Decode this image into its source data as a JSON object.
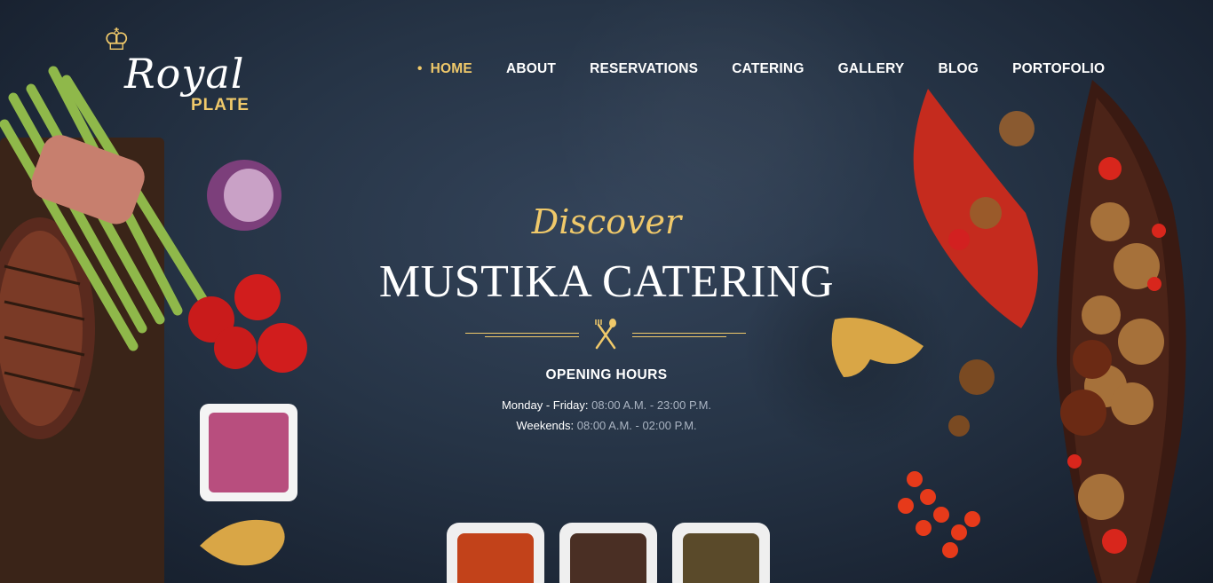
{
  "brand": {
    "logo_word": "Royal",
    "logo_sub": "PLATE"
  },
  "nav": {
    "items": [
      {
        "label": "HOME",
        "active": true
      },
      {
        "label": "ABOUT"
      },
      {
        "label": "RESERVATIONS"
      },
      {
        "label": "CATERING"
      },
      {
        "label": "GALLERY"
      },
      {
        "label": "BLOG"
      },
      {
        "label": "PORTOFOLIO"
      }
    ]
  },
  "hero": {
    "script": "Discover",
    "title": "MUSTIKA CATERING",
    "divider_icon": "fork-spoon-icon"
  },
  "hours": {
    "heading": "OPENING HOURS",
    "rows": [
      {
        "label": "Monday - Friday:",
        "value": "08:00 A.M. - 23:00 P.M."
      },
      {
        "label": "Weekends:",
        "value": "08:00 A.M. - 02:00 P.M."
      }
    ]
  },
  "colors": {
    "accent": "#f0c96a",
    "background": "#263446"
  }
}
